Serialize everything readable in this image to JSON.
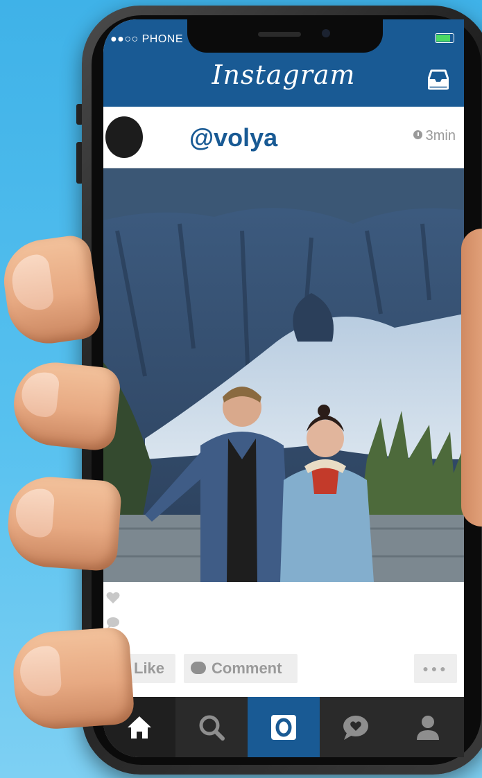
{
  "status": {
    "carrier": "●●○○ PHONE"
  },
  "header": {
    "title": "Instagram",
    "inbox_icon": "inbox-tray-icon"
  },
  "post": {
    "username": "@volya",
    "time": "3min",
    "likes_icon": "heart-icon",
    "comments_icon": "comment-bubble-icon"
  },
  "actions": {
    "like_label": "Like",
    "comment_label": "Comment",
    "more_label": "●●●"
  },
  "nav": {
    "items": [
      {
        "icon": "home-icon"
      },
      {
        "icon": "search-icon"
      },
      {
        "icon": "camera-icon"
      },
      {
        "icon": "activity-bubble-icon"
      },
      {
        "icon": "profile-icon"
      }
    ]
  },
  "colors": {
    "brand": "#195a94",
    "background": "#4bb9ec",
    "nav": "#2a2a2a"
  }
}
